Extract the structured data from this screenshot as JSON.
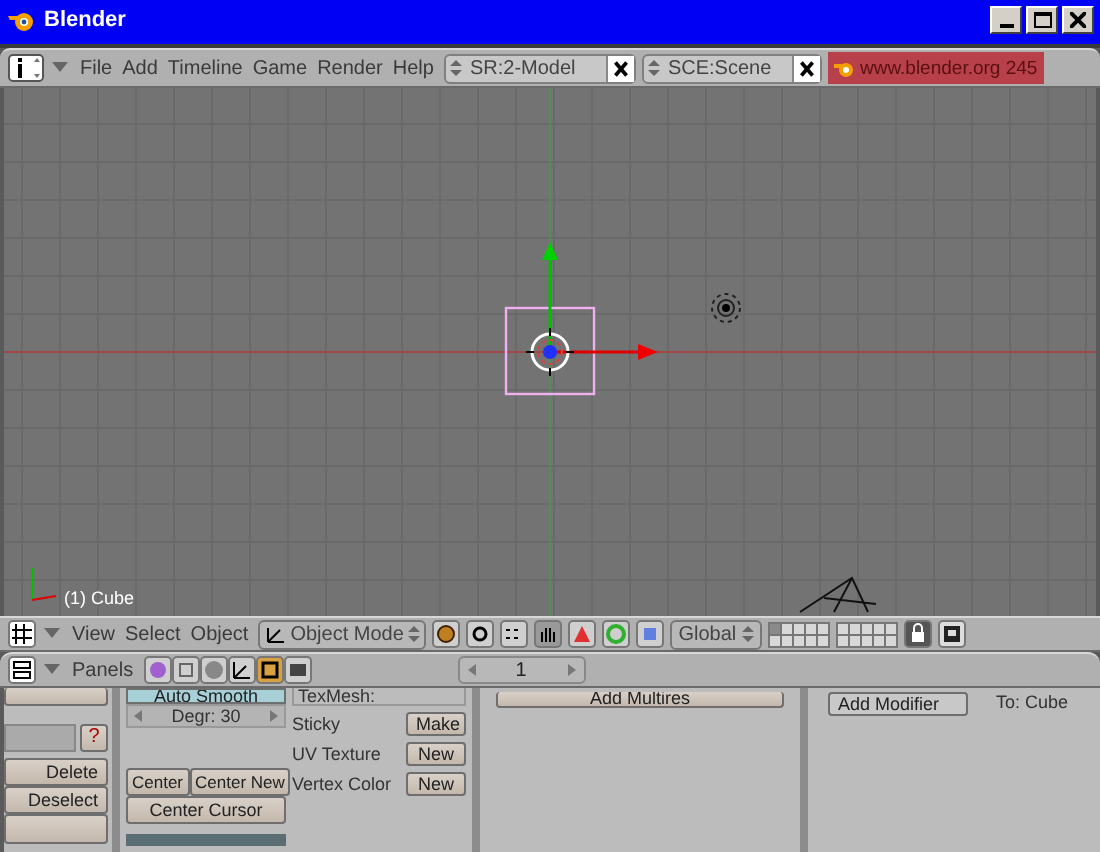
{
  "window": {
    "title": "Blender"
  },
  "top_header": {
    "menus": [
      "File",
      "Add",
      "Timeline",
      "Game",
      "Render",
      "Help"
    ],
    "screen_field": "SR:2-Model",
    "scene_field": "SCE:Scene",
    "version_label": "www.blender.org 245"
  },
  "viewport": {
    "object_label": "(1) Cube"
  },
  "view3d_header": {
    "menus": [
      "View",
      "Select",
      "Object"
    ],
    "mode": "Object Mode",
    "orientation": "Global"
  },
  "buttons_header": {
    "label": "Panels",
    "frame": "1"
  },
  "link_panel": {
    "help_button": "?",
    "buttons": [
      "Delete",
      "Deselect"
    ]
  },
  "mesh_panel": {
    "auto_smooth": "Auto Smooth",
    "degree": "Degr: 30",
    "center_buttons": [
      "Center",
      "Center New"
    ],
    "center_cursor": "Center Cursor"
  },
  "texmesh_panel": {
    "title": "TexMesh:",
    "rows": [
      {
        "label": "Sticky",
        "button": "Make"
      },
      {
        "label": "UV Texture",
        "button": "New"
      },
      {
        "label": "Vertex Color",
        "button": "New"
      }
    ]
  },
  "multires_panel": {
    "button": "Add Multires"
  },
  "modifiers_panel": {
    "button": "Add Modifier",
    "target": "To: Cube"
  }
}
